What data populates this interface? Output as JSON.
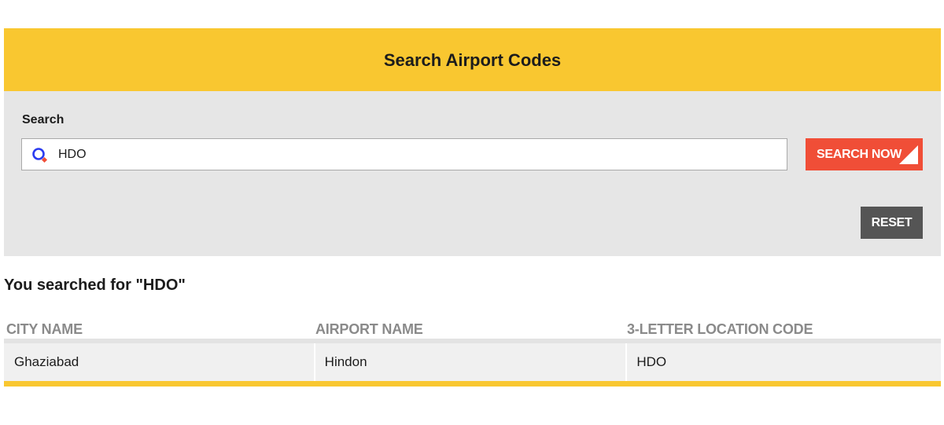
{
  "header": {
    "title": "Search Airport Codes"
  },
  "search": {
    "label": "Search",
    "value": "HDO",
    "search_button": "SEARCH NOW",
    "reset_button": "RESET"
  },
  "results": {
    "heading": "You searched for \"HDO\"",
    "columns": [
      "CITY NAME",
      "AIRPORT NAME",
      "3-LETTER LOCATION CODE"
    ],
    "rows": [
      {
        "city": "Ghaziabad",
        "airport": "Hindon",
        "code": "HDO"
      }
    ]
  },
  "colors": {
    "brand_yellow": "#f9c730",
    "search_red": "#f04e37",
    "reset_gray": "#555555",
    "icon_blue": "#2b3cf0"
  },
  "icons": [
    "search-icon",
    "corner-arrow-icon"
  ]
}
